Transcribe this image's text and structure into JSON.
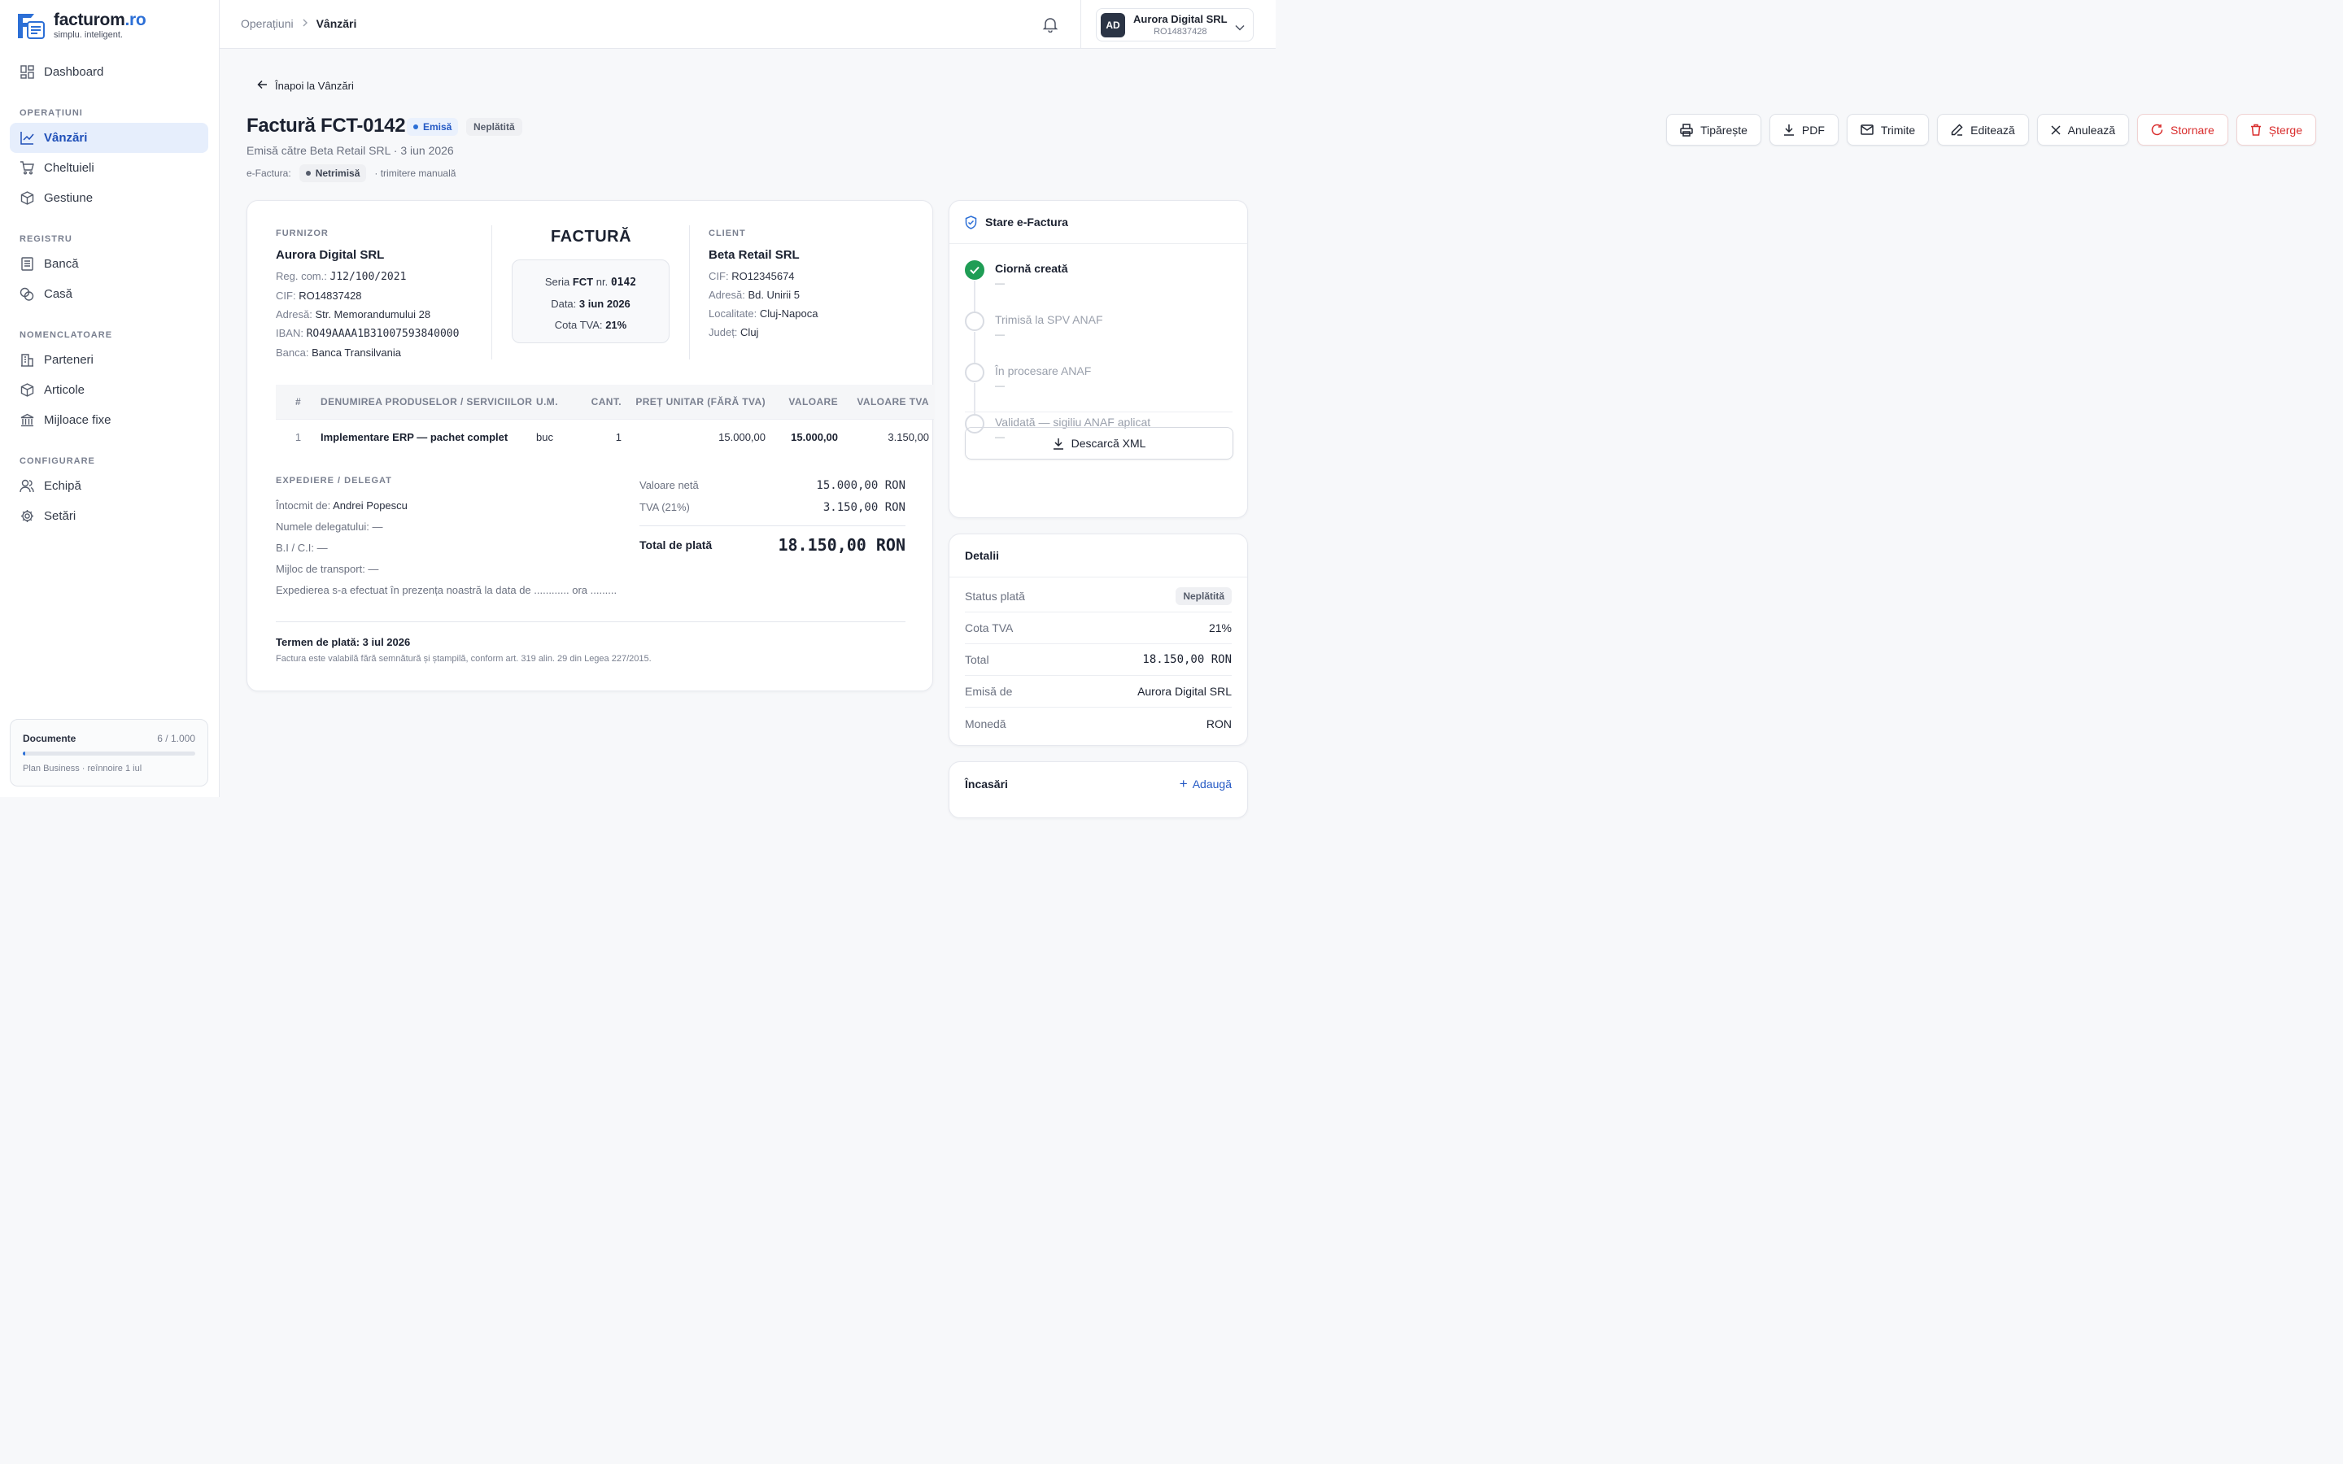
{
  "brand": {
    "name": "facturom",
    "tld": ".ro",
    "tagline": "simplu. inteligent."
  },
  "sidebar": {
    "dashboard": "Dashboard",
    "sections": {
      "operatiuni": "OPERAȚIUNI",
      "registru": "REGISTRU",
      "nomenclatoare": "NOMENCLATOARE",
      "configurare": "CONFIGURARE"
    },
    "items": {
      "vanzari": "Vânzări",
      "cheltuieli": "Cheltuieli",
      "gestiune": "Gestiune",
      "banca": "Bancă",
      "casa": "Casă",
      "parteneri": "Parteneri",
      "articole": "Articole",
      "mijloace": "Mijloace fixe",
      "echipa": "Echipă",
      "setari": "Setări"
    },
    "plan": {
      "label": "Documente",
      "count": "6 / 1.000",
      "used_fraction": 0.006,
      "note": "Plan Business · reînnoire 1 iul"
    }
  },
  "topbar": {
    "crumb_parent": "Operațiuni",
    "crumb_current": "Vânzări",
    "account_name": "Aurora Digital SRL",
    "account_id": "RO14837428",
    "avatar": "AD"
  },
  "header": {
    "back": "Înapoi la Vânzări",
    "title": "Factură FCT-0142",
    "badge_status": "Emisă",
    "badge_payment": "Neplătită",
    "subtitle": "Emisă către Beta Retail SRL · 3 iun 2026",
    "efactura_label": "e-Factura:",
    "efactura_status": "Netrimisă",
    "efactura_mode": "· trimitere manuală"
  },
  "actions": {
    "print": "Tipărește",
    "pdf": "PDF",
    "send": "Trimite",
    "edit": "Editează",
    "cancel": "Anulează",
    "reverse": "Stornare",
    "delete": "Șterge"
  },
  "invoice": {
    "supplier_label": "FURNIZOR",
    "supplier": {
      "name": "Aurora Digital SRL",
      "regcom_k": "Reg. com.:",
      "regcom": "J12/100/2021",
      "cif_k": "CIF:",
      "cif": "RO14837428",
      "addr_k": "Adresă:",
      "addr": "Str. Memorandumului 28",
      "iban_k": "IBAN:",
      "iban": "RO49AAAA1B31007593840000",
      "bank_k": "Banca:",
      "bank": "Banca Transilvania"
    },
    "doc_title": "FACTURĂ",
    "series_k": "Seria",
    "series": "FCT",
    "nr_k": "nr.",
    "nr": "0142",
    "date_k": "Data:",
    "date": "3 iun 2026",
    "vat_k": "Cota TVA:",
    "vat": "21%",
    "client_label": "CLIENT",
    "client": {
      "name": "Beta Retail SRL",
      "cif_k": "CIF:",
      "cif": "RO12345674",
      "addr_k": "Adresă:",
      "addr": "Bd. Unirii 5",
      "city_k": "Localitate:",
      "city": "Cluj-Napoca",
      "county_k": "Județ:",
      "county": "Cluj"
    },
    "table": {
      "headers": [
        "#",
        "DENUMIREA PRODUSELOR / SERVICIILOR",
        "U.M.",
        "CANT.",
        "PREȚ UNITAR (FĂRĂ TVA)",
        "VALOARE",
        "VALOARE TVA"
      ],
      "rows": [
        [
          "1",
          "Implementare ERP — pachet complet",
          "buc",
          "1",
          "15.000,00",
          "15.000,00",
          "3.150,00"
        ]
      ]
    },
    "shipping": {
      "label": "EXPEDIERE / DELEGAT",
      "made_by_k": "Întocmit de:",
      "made_by": "Andrei Popescu",
      "delegate": "Numele delegatului: —",
      "id": "B.I / C.I: —",
      "transport": "Mijloc de transport: —",
      "note": "Expedierea s-a efectuat în prezența noastră la data de ............ ora ........."
    },
    "totals": {
      "net_k": "Valoare netă",
      "net": "15.000,00 RON",
      "vat_k": "TVA (21%)",
      "vat": "3.150,00 RON",
      "total_k": "Total de plată",
      "total": "18.150,00 RON"
    },
    "terms": "Termen de plată: 3 iul 2026",
    "legal": "Factura este valabilă fără semnătură și ștampilă, conform art. 319 alin. 29 din Legea 227/2015."
  },
  "efactura_card": {
    "title": "Stare e-Factura",
    "steps": [
      {
        "label": "Ciornă creată",
        "detail": "—",
        "done": true
      },
      {
        "label": "Trimisă la SPV ANAF",
        "detail": "—",
        "done": false
      },
      {
        "label": "În procesare ANAF",
        "detail": "—",
        "done": false
      },
      {
        "label": "Validată — sigiliu ANAF aplicat",
        "detail": "—",
        "done": false
      }
    ],
    "download": "Descarcă XML"
  },
  "details_card": {
    "title": "Detalii",
    "payment_k": "Status plată",
    "payment": "Neplătită",
    "vat_k": "Cota TVA",
    "vat": "21%",
    "total_k": "Total",
    "total": "18.150,00 RON",
    "issued_k": "Emisă de",
    "issued": "Aurora Digital SRL",
    "currency_k": "Monedă",
    "currency": "RON"
  },
  "payments_card": {
    "title": "Încasări",
    "add": "Adaugă"
  },
  "colors": {
    "accent": "#2c6fd6",
    "success": "#1f9d55",
    "danger": "#d92d2d"
  }
}
